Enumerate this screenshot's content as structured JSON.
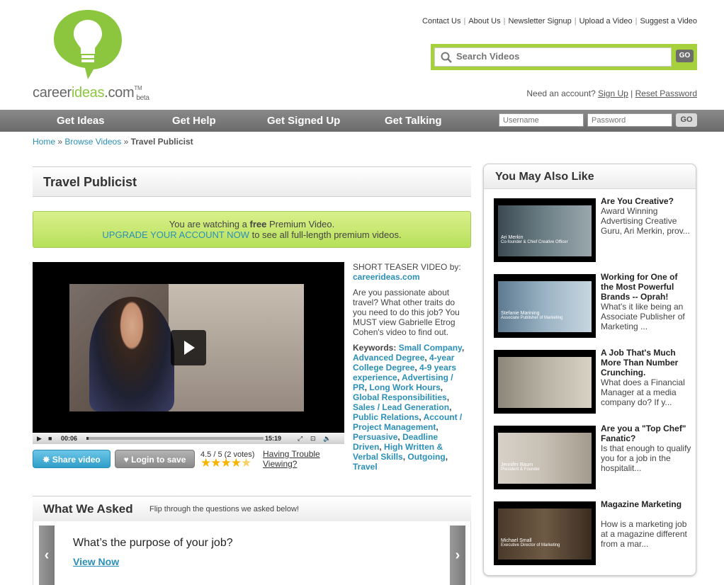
{
  "header": {
    "logo_main": "career",
    "logo_highlight": "ideas",
    "logo_domain": ".com",
    "logo_tm": "TM",
    "logo_beta": "beta",
    "top_links": [
      "Contact Us",
      "About Us",
      "Newsletter Signup",
      "Upload a Video",
      "Suggest a Video"
    ],
    "search_placeholder": "Search Videos",
    "search_go": "GO",
    "account_prompt": "Need an account?",
    "signup_link": "Sign Up",
    "reset_link": "Reset Password"
  },
  "nav": {
    "items": [
      "Get Ideas",
      "Get Help",
      "Get Signed Up",
      "Get Talking"
    ],
    "username_placeholder": "Username",
    "password_placeholder": "Password",
    "go_label": "GO"
  },
  "breadcrumb": {
    "home": "Home",
    "browse": "Browse Videos",
    "current": "Travel Publicist",
    "sep": "»"
  },
  "page_title": "Travel Publicist",
  "upgrade": {
    "line1_pre": "You are watching a",
    "line1_bold": "free",
    "line1_post": "Premium Video.",
    "link": "UPGRADE YOUR ACCOUNT NOW",
    "line2_post": "to see all full-length premium videos."
  },
  "player": {
    "time_current": "00:06",
    "time_total": "15:19",
    "progress_fraction": 0.006
  },
  "actions": {
    "share_label": "Share video",
    "login_label": "Login to save",
    "rating_text": "4.5 / 5",
    "votes_text": "(2 votes)",
    "rating_value": 4.5,
    "trouble_link": "Having Trouble Viewing?"
  },
  "description": {
    "teaser_label": "SHORT TEASER VIDEO by:",
    "site": "careerideas.com",
    "text": "Are you passionate about travel? What other traits do you need to do this job? You MUST view Gabrielle Etrog Cohen's video to find out.",
    "keywords_label": "Keywords:",
    "keywords": [
      "Small Company",
      "Advanced Degree",
      "4-year College Degree",
      "4-9 years experience",
      "Advertising / PR",
      "Long Work Hours",
      "Global Responsibilities",
      "Sales / Lead Generation",
      "Public Relations",
      "Account / Project Management",
      "Persuasive",
      "Deadline Driven",
      "High Written & Verbal Skills",
      "Outgoing",
      "Travel"
    ]
  },
  "asked": {
    "title": "What We Asked",
    "subtitle": "Flip through the questions we asked below!",
    "question": "What’s the purpose of your job?",
    "view_now": "View Now",
    "prev": "‹",
    "next": "›"
  },
  "sidebar": {
    "title": "You May Also Like",
    "items": [
      {
        "title": "Are You Creative?",
        "desc": "Award Winning Advertising Creative Guru, Ari Merkin, prov...",
        "cap_name": "Ari Merkin",
        "cap_role": "Co-founder & Chief Creative Officer"
      },
      {
        "title": "Working for One of the Most Powerful Brands -- Oprah!",
        "desc": "What's it like being an Associate Publisher of Marketing ...",
        "cap_name": "Stefanie Marining",
        "cap_role": "Associate Publisher of Marketing"
      },
      {
        "title": "A Job That's Much More Than Number Crunching.",
        "desc": "What does a Financial Manager at a media company do? If y...",
        "cap_name": "",
        "cap_role": ""
      },
      {
        "title": "Are you a \"Top Chef\" Fanatic?",
        "desc": "Is that enough to qualify you for a job in the hospitalit...",
        "cap_name": "Jennifer Baum",
        "cap_role": "President & Founder"
      },
      {
        "title": "Magazine Marketing",
        "desc": "How is a marketing job at a magazine different from a mar...",
        "cap_name": "Michael Small",
        "cap_role": "Executive Director of Marketing"
      }
    ]
  },
  "colors": {
    "brand_green": "#8cc63f",
    "link_blue": "#2a8fb8",
    "nav_gray": "#777777"
  }
}
